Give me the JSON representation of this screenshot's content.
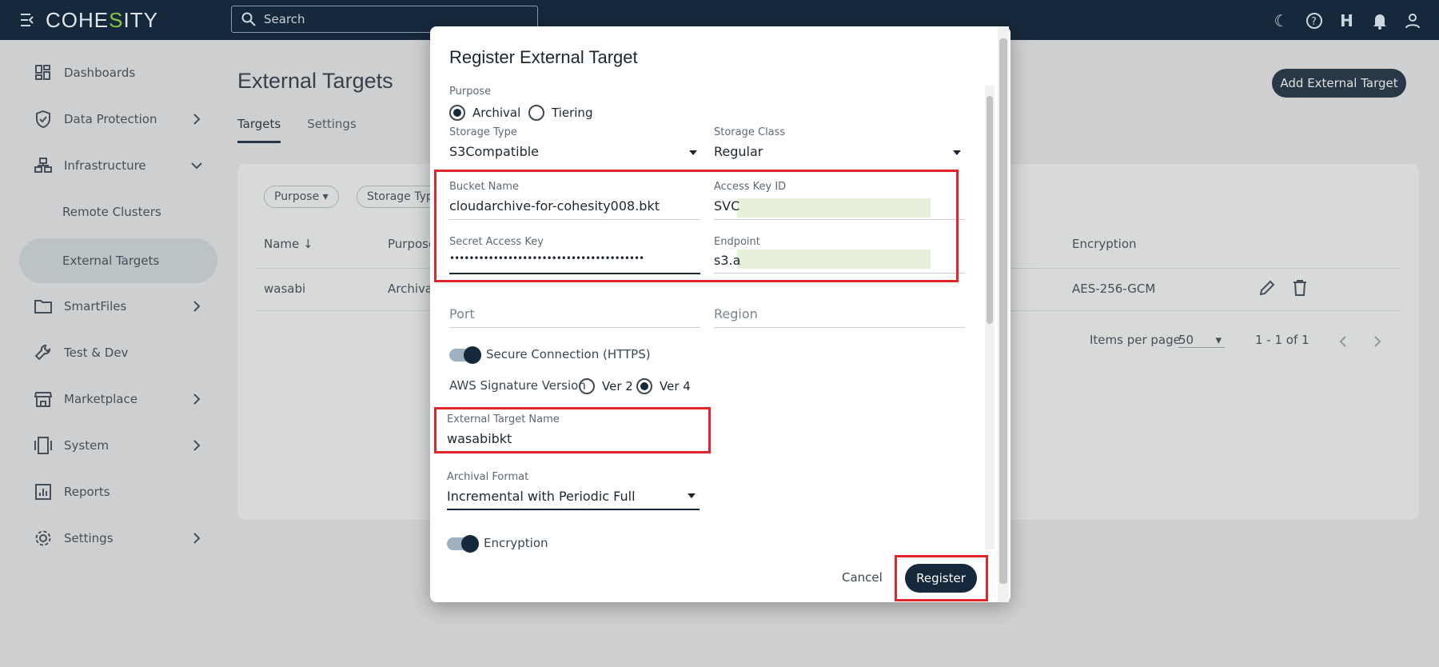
{
  "app": {
    "logo_pre": "COHE",
    "logo_s": "S",
    "logo_post": "ITY",
    "search_placeholder": "Search"
  },
  "sidebar": {
    "items": [
      {
        "label": "Dashboards"
      },
      {
        "label": "Data Protection"
      },
      {
        "label": "Infrastructure"
      },
      {
        "label": "Remote Clusters"
      },
      {
        "label": "External Targets"
      },
      {
        "label": "SmartFiles"
      },
      {
        "label": "Test & Dev"
      },
      {
        "label": "Marketplace"
      },
      {
        "label": "System"
      },
      {
        "label": "Reports"
      },
      {
        "label": "Settings"
      }
    ]
  },
  "page": {
    "title": "External Targets",
    "tabs": [
      "Targets",
      "Settings"
    ],
    "add_button": "Add External Target",
    "filters": [
      "Purpose",
      "Storage Typ"
    ],
    "columns": {
      "name": "Name",
      "purpose": "Purpose",
      "encryption": "Encryption"
    },
    "row": {
      "name": "wasabi",
      "purpose": "Archival",
      "encryption": "AES-256-GCM"
    },
    "items_per_page_label": "Items per page",
    "items_per_page": "50",
    "range": "1 - 1 of 1"
  },
  "dialog": {
    "title": "Register External Target",
    "purpose_label": "Purpose",
    "purpose_options": [
      "Archival",
      "Tiering"
    ],
    "storage_type_label": "Storage Type",
    "storage_type": "S3Compatible",
    "storage_class_label": "Storage Class",
    "storage_class": "Regular",
    "bucket_name_label": "Bucket Name",
    "bucket_name": "cloudarchive-for-cohesity008.bkt",
    "access_key_label": "Access Key ID",
    "access_key": "SVC",
    "secret_key_label": "Secret Access Key",
    "secret_key": "••••••••••••••••••••••••••••••••••••••••",
    "endpoint_label": "Endpoint",
    "endpoint": "s3.a",
    "port_placeholder": "Port",
    "region_placeholder": "Region",
    "secure_connection": "Secure Connection (HTTPS)",
    "aws_sig_label": "AWS Signature Version",
    "aws_sig_options": [
      "Ver 2",
      "Ver 4"
    ],
    "target_name_label": "External Target Name",
    "target_name": "wasabibkt",
    "archival_format_label": "Archival Format",
    "archival_format": "Incremental with Periodic Full",
    "encryption": "Encryption",
    "cancel": "Cancel",
    "register": "Register"
  },
  "colors": {
    "navy": "#16283b",
    "highlight_red": "#e0262b",
    "mask_green": "#e6f0da",
    "logo_green": "#8ac53f"
  }
}
